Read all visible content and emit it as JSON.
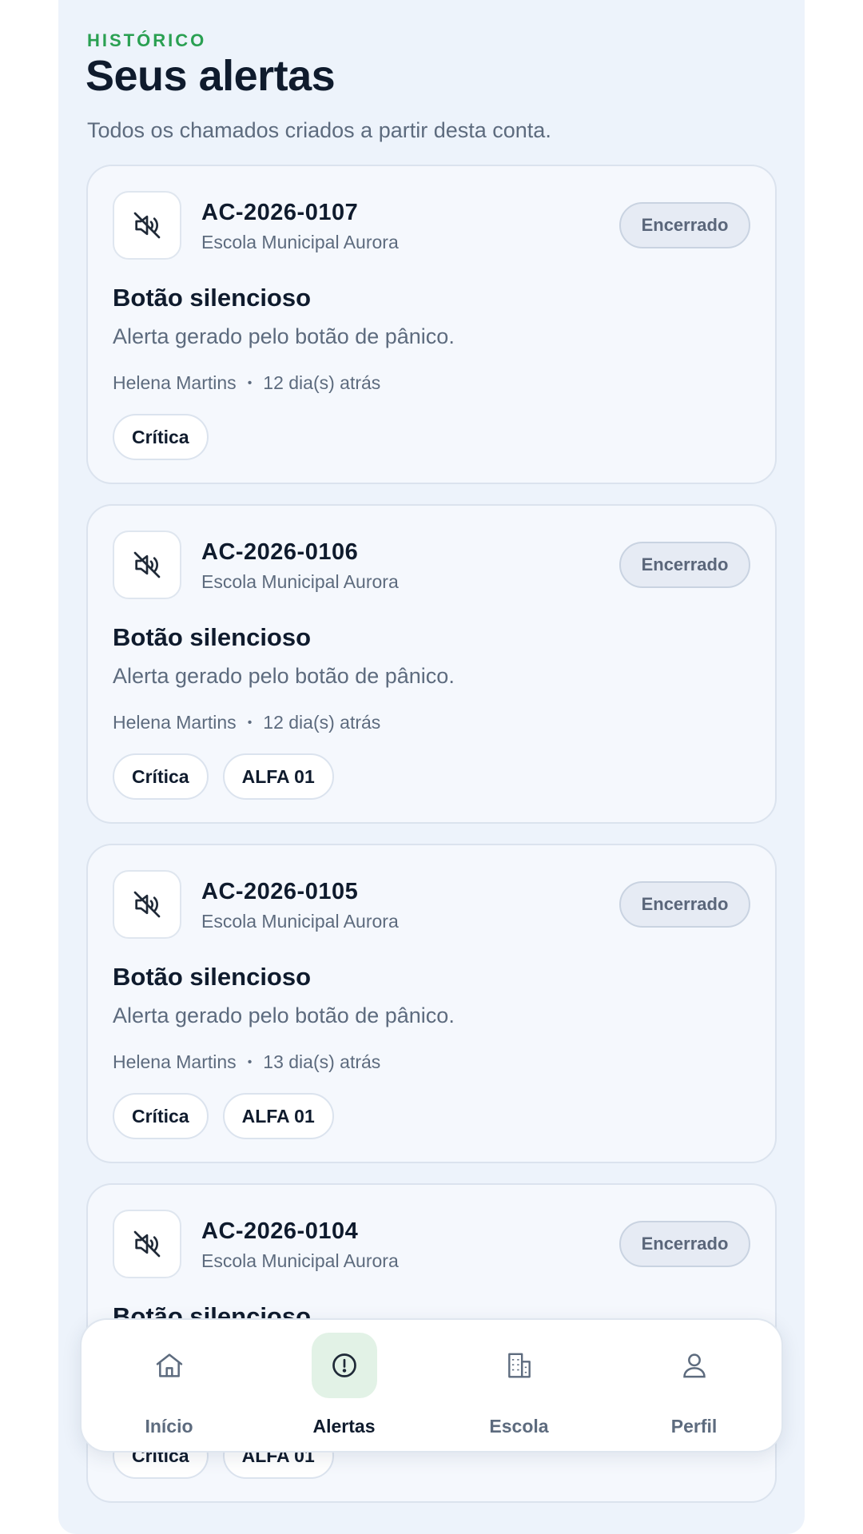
{
  "header": {
    "overline": "HISTÓRICO",
    "title": "Seus alertas",
    "subtitle": "Todos os chamados criados a partir desta conta."
  },
  "alerts": [
    {
      "icon": "muted-speaker-icon",
      "id": "AC-2026-0107",
      "school": "Escola Municipal Aurora",
      "status": "Encerrado",
      "title": "Botão silencioso",
      "description": "Alerta gerado pelo botão de pânico.",
      "author": "Helena Martins",
      "time": "12 dia(s) atrás",
      "tags": [
        "Crítica"
      ]
    },
    {
      "icon": "muted-speaker-icon",
      "id": "AC-2026-0106",
      "school": "Escola Municipal Aurora",
      "status": "Encerrado",
      "title": "Botão silencioso",
      "description": "Alerta gerado pelo botão de pânico.",
      "author": "Helena Martins",
      "time": "12 dia(s) atrás",
      "tags": [
        "Crítica",
        "ALFA 01"
      ]
    },
    {
      "icon": "muted-speaker-icon",
      "id": "AC-2026-0105",
      "school": "Escola Municipal Aurora",
      "status": "Encerrado",
      "title": "Botão silencioso",
      "description": "Alerta gerado pelo botão de pânico.",
      "author": "Helena Martins",
      "time": "13 dia(s) atrás",
      "tags": [
        "Crítica",
        "ALFA 01"
      ]
    },
    {
      "icon": "muted-speaker-icon",
      "id": "AC-2026-0104",
      "school": "Escola Municipal Aurora",
      "status": "Encerrado",
      "title": "Botão silencioso",
      "description": "",
      "author": "",
      "time": "",
      "tags": [
        "Crítica",
        "ALFA 01"
      ]
    }
  ],
  "nav": {
    "items": [
      {
        "label": "Início",
        "icon": "home-icon",
        "active": false
      },
      {
        "label": "Alertas",
        "icon": "alert-circle-icon",
        "active": true
      },
      {
        "label": "Escola",
        "icon": "building-icon",
        "active": false
      },
      {
        "label": "Perfil",
        "icon": "user-icon",
        "active": false
      }
    ]
  },
  "colors": {
    "accent": "#2aa052",
    "active_nav_bg": "#e2f2e6",
    "background": "#edf3fb"
  }
}
